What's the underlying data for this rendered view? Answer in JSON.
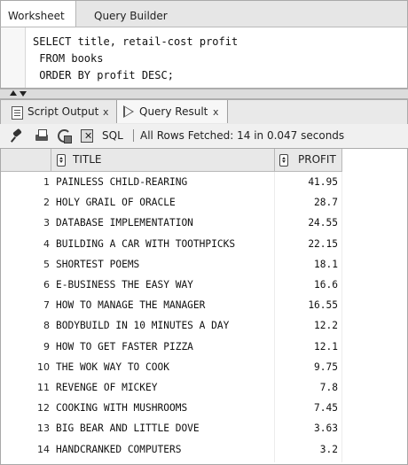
{
  "editor_tabs": [
    {
      "label": "Worksheet",
      "active": true
    },
    {
      "label": "Query Builder",
      "active": false
    }
  ],
  "editor": {
    "lines": [
      "SELECT title, retail-cost profit",
      " FROM books",
      " ORDER BY profit DESC;"
    ]
  },
  "result_tabs": [
    {
      "label": "Script Output",
      "close": "x",
      "icon": "script-icon"
    },
    {
      "label": "Query Result",
      "close": "x",
      "icon": "play-icon",
      "active": true
    }
  ],
  "toolbar": {
    "sql_label": "SQL",
    "status": "All Rows Fetched: 14 in 0.047 seconds"
  },
  "grid": {
    "columns": [
      "TITLE",
      "PROFIT"
    ],
    "rows": [
      {
        "n": "1",
        "title": "PAINLESS CHILD-REARING",
        "profit": "41.95"
      },
      {
        "n": "2",
        "title": "HOLY GRAIL OF ORACLE",
        "profit": "28.7"
      },
      {
        "n": "3",
        "title": "DATABASE IMPLEMENTATION",
        "profit": "24.55"
      },
      {
        "n": "4",
        "title": "BUILDING A CAR WITH TOOTHPICKS",
        "profit": "22.15"
      },
      {
        "n": "5",
        "title": "SHORTEST POEMS",
        "profit": "18.1"
      },
      {
        "n": "6",
        "title": "E-BUSINESS THE EASY WAY",
        "profit": "16.6"
      },
      {
        "n": "7",
        "title": "HOW TO MANAGE THE MANAGER",
        "profit": "16.55"
      },
      {
        "n": "8",
        "title": "BODYBUILD IN 10 MINUTES A DAY",
        "profit": "12.2"
      },
      {
        "n": "9",
        "title": "HOW TO GET FASTER PIZZA",
        "profit": "12.1"
      },
      {
        "n": "10",
        "title": "THE WOK WAY TO COOK",
        "profit": "9.75"
      },
      {
        "n": "11",
        "title": "REVENGE OF MICKEY",
        "profit": "7.8"
      },
      {
        "n": "12",
        "title": "COOKING WITH MUSHROOMS",
        "profit": "7.45"
      },
      {
        "n": "13",
        "title": "BIG BEAR AND LITTLE DOVE",
        "profit": "3.63"
      },
      {
        "n": "14",
        "title": "HANDCRANKED COMPUTERS",
        "profit": "3.2"
      }
    ]
  }
}
